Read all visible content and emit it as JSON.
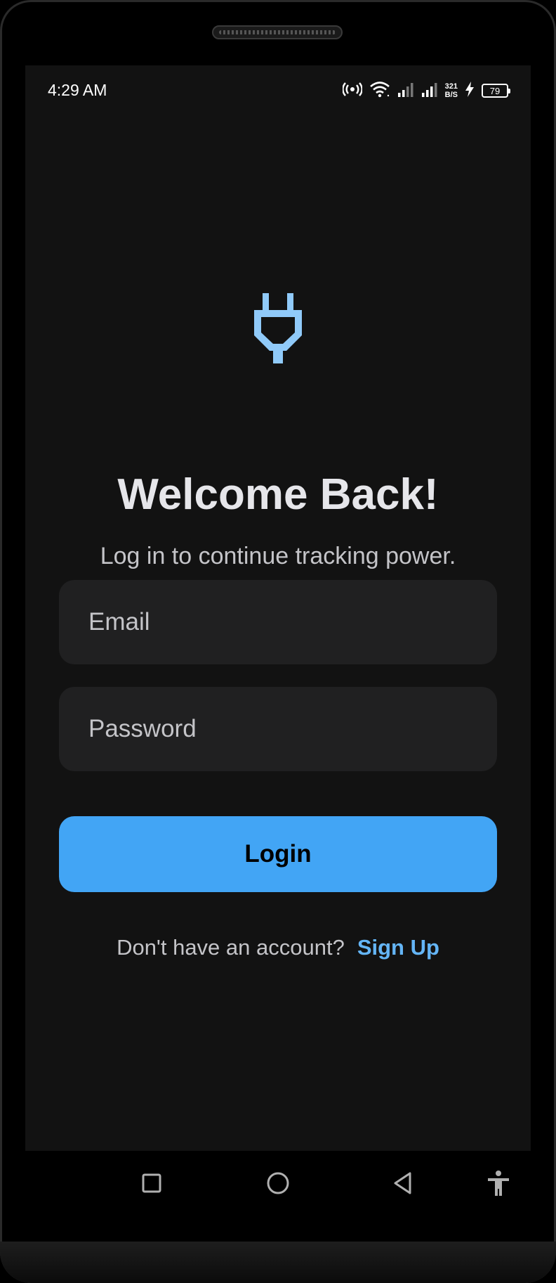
{
  "status_bar": {
    "time": "4:29 AM",
    "net_speed_value": "321",
    "net_speed_unit": "B/S",
    "battery_level": "79",
    "icons": [
      "hotspot-icon",
      "wifi-icon",
      "signal-icon",
      "signal-icon",
      "charging-icon",
      "battery-icon"
    ]
  },
  "login": {
    "logo_icon": "plug-icon",
    "title": "Welcome Back!",
    "subtitle": "Log in to continue tracking power.",
    "email_placeholder": "Email",
    "email_value": "",
    "password_placeholder": "Password",
    "password_value": "",
    "login_label": "Login",
    "signup_prompt": "Don't have an account?",
    "signup_label": "Sign Up"
  },
  "navigation": {
    "buttons": [
      "recents-icon",
      "home-icon",
      "back-icon",
      "accessibility-icon"
    ]
  },
  "colors": {
    "background": "#121212",
    "accent": "#42a5f5",
    "link": "#64b5f6",
    "logo": "#90caf9",
    "field_background": "#202021"
  }
}
